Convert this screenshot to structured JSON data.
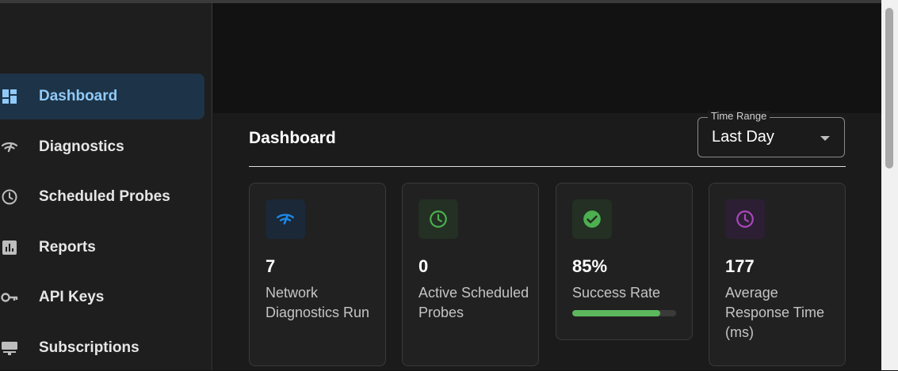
{
  "sidebar": {
    "items": [
      {
        "label": "Dashboard",
        "icon": "dashboard-icon",
        "active": true
      },
      {
        "label": "Diagnostics",
        "icon": "network-icon",
        "active": false
      },
      {
        "label": "Scheduled Probes",
        "icon": "clock-icon",
        "active": false
      },
      {
        "label": "Reports",
        "icon": "bar-chart-icon",
        "active": false
      },
      {
        "label": "API Keys",
        "icon": "key-icon",
        "active": false
      },
      {
        "label": "Subscriptions",
        "icon": "subscription-icon",
        "active": false
      }
    ]
  },
  "main": {
    "title": "Dashboard",
    "time_range": {
      "legend": "Time Range",
      "value": "Last Day"
    },
    "cards": [
      {
        "value": "7",
        "label": "Network Diagnostics Run",
        "icon": "network-icon",
        "accent": "#1e88e5"
      },
      {
        "value": "0",
        "label": "Active Scheduled Probes",
        "icon": "clock-icon",
        "accent": "#4caf50"
      },
      {
        "value": "85%",
        "label": "Success Rate",
        "icon": "check-circle-icon",
        "accent": "#4caf50",
        "progress": 0.85
      },
      {
        "value": "177",
        "label": "Average Response Time (ms)",
        "icon": "clock-icon",
        "accent": "#ab47bc"
      }
    ]
  },
  "colors": {
    "accent": "#90caf9",
    "active_bg": "#1d3347",
    "success": "#5cb85c"
  }
}
